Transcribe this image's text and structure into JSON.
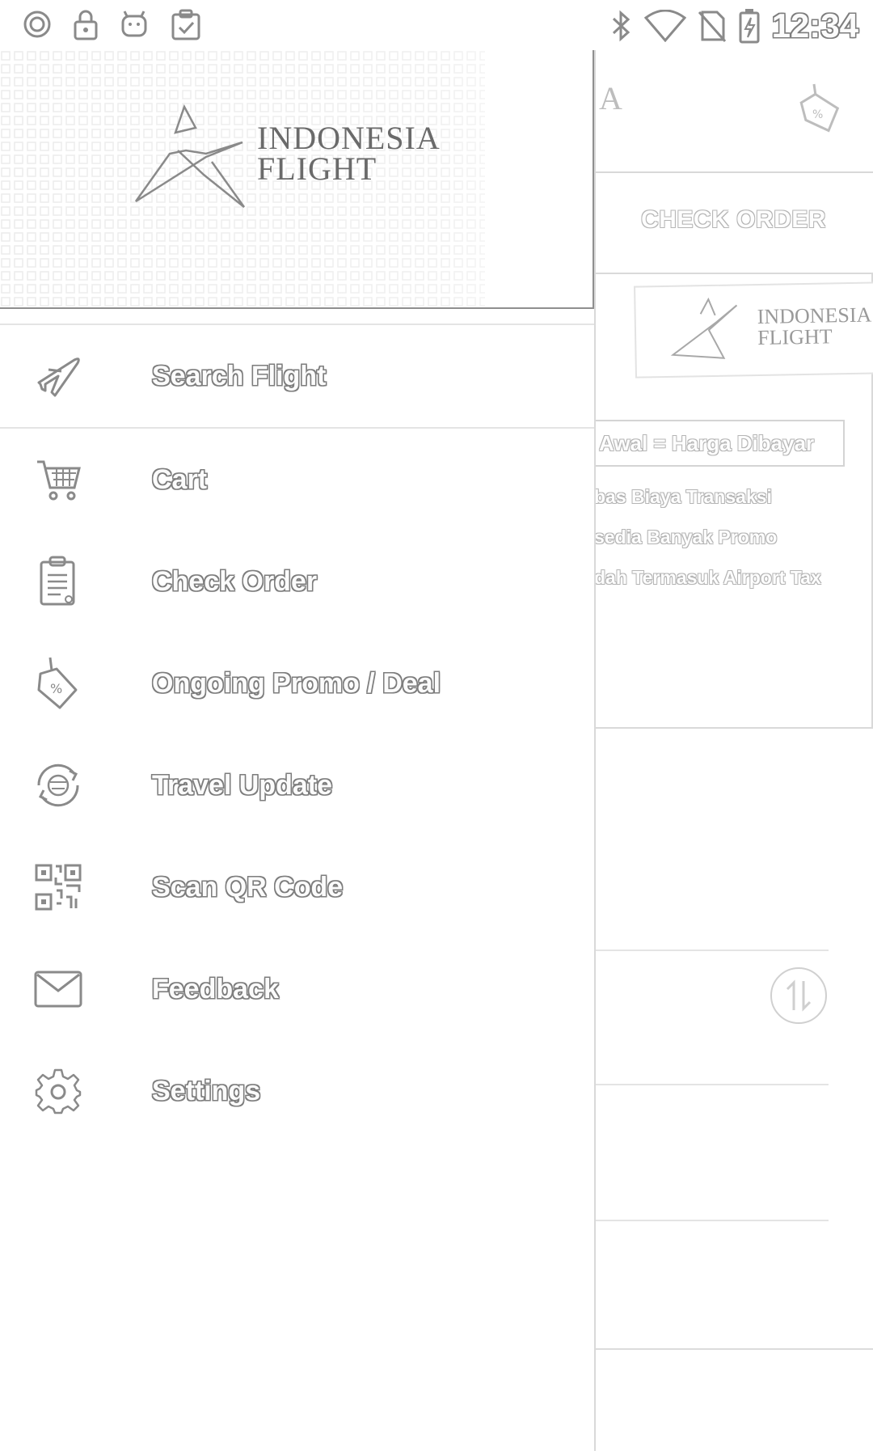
{
  "status_bar": {
    "time": "12:34",
    "left_icons": [
      "notification-circle-icon",
      "lock-icon",
      "android-icon",
      "clipboard-check-icon"
    ],
    "right_icons": [
      "bluetooth-icon",
      "wifi-icon",
      "no-sim-icon",
      "battery-charging-icon"
    ]
  },
  "drawer": {
    "brand": {
      "line1": "INDONESIA",
      "line2": "FLIGHT"
    },
    "menu": [
      {
        "label": "Search Flight",
        "icon": "airplane-icon",
        "active": true
      },
      {
        "label": "Cart",
        "icon": "cart-icon"
      },
      {
        "label": "Check Order",
        "icon": "clipboard-icon"
      },
      {
        "label": "Ongoing Promo / Deal",
        "icon": "promo-tag-icon"
      },
      {
        "label": "Travel Update",
        "icon": "travel-update-icon"
      },
      {
        "label": "Scan QR Code",
        "icon": "qr-code-icon"
      },
      {
        "label": "Feedback",
        "icon": "mail-icon"
      },
      {
        "label": "Settings",
        "icon": "gear-icon"
      }
    ]
  },
  "background_screen": {
    "header_partial": "A",
    "check_order": "CHECK ORDER",
    "brand": {
      "line1": "INDONESIA",
      "line2": "FLIGHT"
    },
    "price_banner": "Awal = Harga Dibayar",
    "features": [
      "bas Biaya Transaksi",
      "sedia Banyak Promo",
      "dah Termasuk Airport Tax"
    ]
  }
}
